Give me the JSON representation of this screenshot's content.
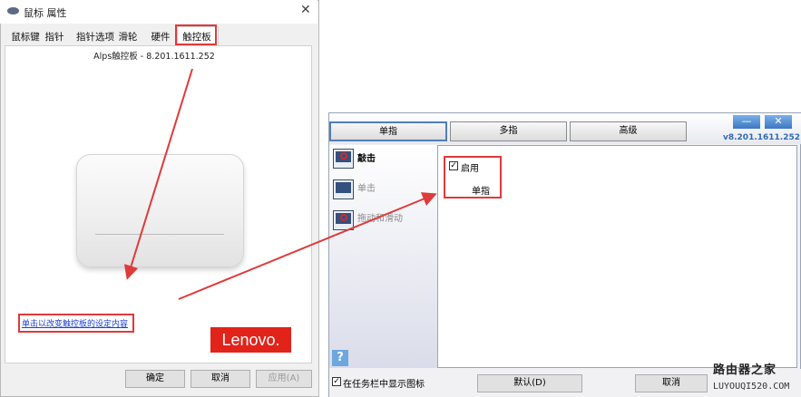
{
  "mouse_window": {
    "title": "鼠标 属性",
    "close_glyph": "✕",
    "tabs": [
      "鼠标键",
      "指针",
      "指针选项",
      "滑轮",
      "硬件",
      "触控板"
    ],
    "active_tab": "触控板",
    "version_text": "Alps触控板 - 8.201.1611.252",
    "change_link": "单击以改变触控板的设定内容",
    "logo_text": "Lenovo.",
    "buttons": {
      "ok": "确定",
      "cancel": "取消",
      "apply": "应用(A)"
    }
  },
  "synaptics_window": {
    "tabs": [
      "单指",
      "多指",
      "高级"
    ],
    "active_tab": "单指",
    "minimize_glyph": "—",
    "close_glyph": "✕",
    "version": "v8.201.1611.252",
    "nav_items": [
      "敲击",
      "单击",
      "拖动和滑动"
    ],
    "enable_label": "启用",
    "single_finger_label": "单指",
    "help_glyph": "?",
    "show_taskbar_label": "在任务栏中显示图标",
    "default_button": "默认(D)",
    "cancel_button": "取消"
  },
  "watermark": {
    "text": "路由器之家",
    "url": "LUYOUQI520.COM"
  },
  "colors": {
    "annotation_red": "#e03a3a",
    "lenovo_red": "#e2231a",
    "link_blue": "#1a3fd6",
    "version_blue": "#2f6bb3"
  },
  "icons": [
    "mouse-icon",
    "close-icon",
    "touchpad-icon",
    "tap-icon",
    "click-icon",
    "drag-icon",
    "help-icon",
    "checkbox-icon"
  ]
}
